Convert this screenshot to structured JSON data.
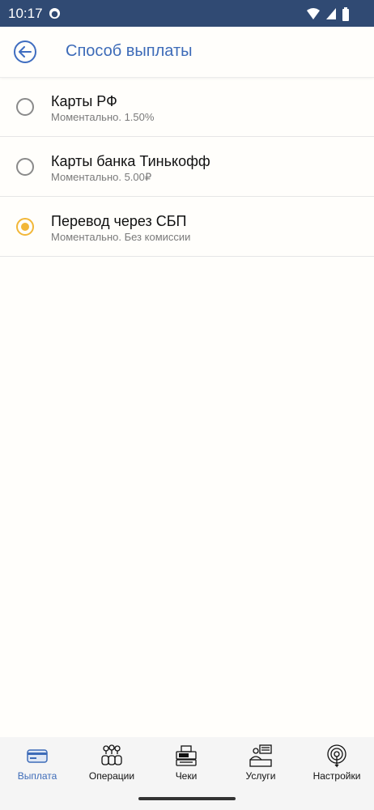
{
  "status": {
    "time": "10:17"
  },
  "header": {
    "title": "Способ выплаты"
  },
  "options": [
    {
      "title": "Карты РФ",
      "subtitle": "Моментально. 1.50%",
      "selected": false
    },
    {
      "title": "Карты банка Тинькофф",
      "subtitle": "Моментально. 5.00₽",
      "selected": false
    },
    {
      "title": "Перевод через СБП",
      "subtitle": "Моментально. Без комиссии",
      "selected": true
    }
  ],
  "nav": [
    {
      "label": "Выплата",
      "icon": "card-icon",
      "active": true
    },
    {
      "label": "Операции",
      "icon": "money-bags-icon",
      "active": false
    },
    {
      "label": "Чеки",
      "icon": "cash-register-icon",
      "active": false
    },
    {
      "label": "Услуги",
      "icon": "service-counter-icon",
      "active": false
    },
    {
      "label": "Настройки",
      "icon": "settings-gear-icon",
      "active": false
    }
  ],
  "colors": {
    "status_bar": "#304a73",
    "accent": "#3d6bb8",
    "radio_selected": "#f2b738"
  }
}
